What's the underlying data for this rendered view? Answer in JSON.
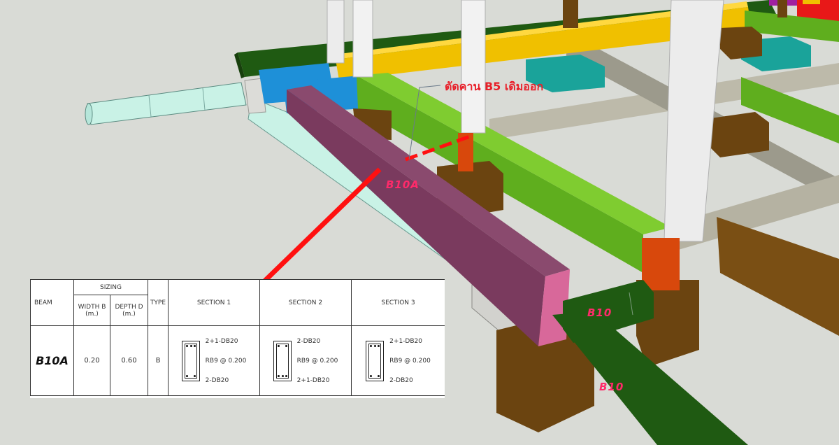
{
  "annotations": {
    "cut_note": "ตัดคาน  B5 เดิมออก",
    "b10a_label": "B10A",
    "b10_label_1": "B10",
    "b10_label_2": "B10"
  },
  "schedule": {
    "col_beam": "BEAM",
    "col_sizing": "SIZING",
    "col_width": "WIDTH B",
    "col_width_unit": "(m.)",
    "col_depth": "DEPTH D",
    "col_depth_unit": "(m.)",
    "col_type": "TYPE",
    "col_section1": "SECTION 1",
    "col_section2": "SECTION 2",
    "col_section3": "SECTION 3",
    "row": {
      "beam": "B10A",
      "width": "0.20",
      "depth": "0.60",
      "type": "B",
      "s1_top": "2+1-DB20",
      "s1_stirrup": "RB9 @ 0.200",
      "s1_bottom": "2-DB20",
      "s2_top": "2-DB20",
      "s2_stirrup": "RB9 @ 0.200",
      "s2_bottom": "2+1-DB20",
      "s3_top": "2+1-DB20",
      "s3_stirrup": "RB9 @ 0.200",
      "s3_bottom": "2-DB20"
    }
  },
  "colors": {
    "background": "#d9dbd6",
    "beam_b10a": "#7a3a5e",
    "beam_b10": "#1f5a12",
    "beam_green": "#5fae1e",
    "beam_yellow": "#f0c000",
    "beam_blue": "#1e90d8",
    "footing": "#6b4410",
    "column": "#ececec",
    "pipe": "#c9f2e6",
    "red_marker": "#ff1010",
    "annotation_text": "#ff2a6a"
  }
}
